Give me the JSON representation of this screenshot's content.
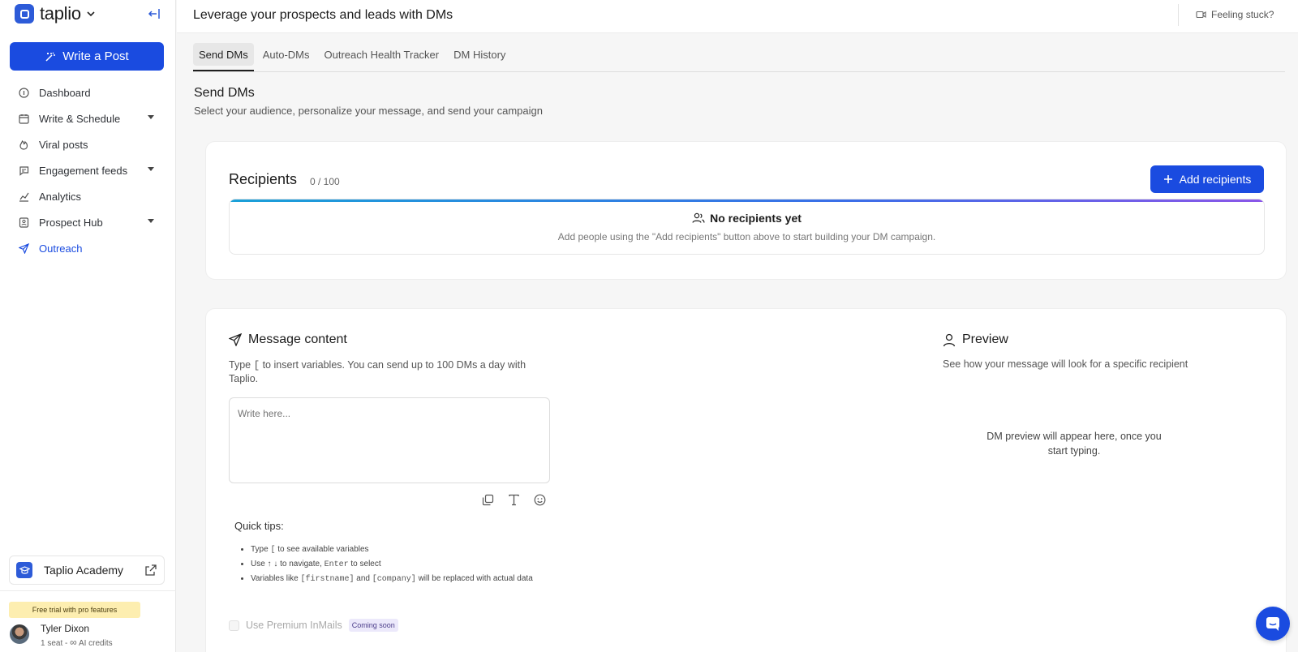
{
  "brand": {
    "name": "taplio"
  },
  "sidebar": {
    "write_post": "Write a Post",
    "items": [
      {
        "label": "Dashboard",
        "icon": "info-circle-icon",
        "has_caret": false
      },
      {
        "label": "Write & Schedule",
        "icon": "calendar-icon",
        "has_caret": true
      },
      {
        "label": "Viral posts",
        "icon": "flame-icon",
        "has_caret": false
      },
      {
        "label": "Engagement feeds",
        "icon": "chat-icon",
        "has_caret": true
      },
      {
        "label": "Analytics",
        "icon": "chart-line-icon",
        "has_caret": false
      },
      {
        "label": "Prospect Hub",
        "icon": "contact-card-icon",
        "has_caret": true
      },
      {
        "label": "Outreach",
        "icon": "paper-plane-icon",
        "has_caret": false,
        "active": true
      }
    ],
    "academy": "Taplio Academy",
    "trial_badge": "Free trial with pro features",
    "user": {
      "name": "Tyler Dixon",
      "seats": "1 seat - ",
      "credits": "AI credits"
    }
  },
  "header": {
    "title": "Leverage your prospects and leads with DMs",
    "help": "Feeling stuck?"
  },
  "tabs": [
    {
      "label": "Send DMs",
      "active": true
    },
    {
      "label": "Auto-DMs"
    },
    {
      "label": "Outreach Health Tracker"
    },
    {
      "label": "DM History"
    }
  ],
  "section": {
    "title": "Send DMs",
    "subtitle": "Select your audience, personalize your message, and send your campaign"
  },
  "recipients": {
    "title": "Recipients",
    "count": "0 / 100",
    "add_button": "Add recipients",
    "empty_title": "No recipients yet",
    "empty_sub": "Add people using the \"Add recipients\" button above to start building your DM campaign."
  },
  "message": {
    "title": "Message content",
    "desc_before": "Type ",
    "desc_key": "[",
    "desc_after": " to insert variables. You can send up to 100 DMs a day with Taplio.",
    "placeholder": "Write here...",
    "tips_title": "Quick tips:",
    "tip1_a": "Type ",
    "tip1_code": "[",
    "tip1_b": " to see available variables",
    "tip2_a": "Use ↑ ↓ to navigate, ",
    "tip2_code": "Enter",
    "tip2_b": " to select",
    "tip3_a": "Variables like ",
    "tip3_code1": "[firstname]",
    "tip3_mid": " and ",
    "tip3_code2": "[company]",
    "tip3_b": " will be replaced with actual data",
    "premium_label": "Use Premium InMails",
    "premium_badge": "Coming soon"
  },
  "preview": {
    "title": "Preview",
    "desc": "See how your message will look for a specific recipient",
    "empty": "DM preview will appear here, once you start typing."
  },
  "colors": {
    "accent": "#1a4be0",
    "trial": "#fdeeb0"
  }
}
